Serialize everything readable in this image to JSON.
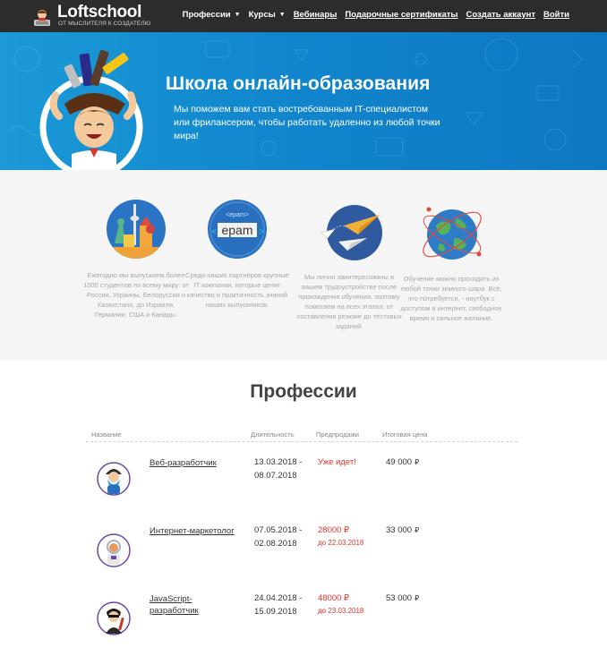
{
  "nav": {
    "logo_name": "Loftschool",
    "logo_tagline": "ОТ МЫСЛИТЕЛЯ К СОЗДАТЕЛЮ",
    "links": [
      {
        "label": "Профессии",
        "has_caret": true
      },
      {
        "label": "Курсы",
        "has_caret": true
      },
      {
        "label": "Вебинары"
      },
      {
        "label": "Подарочные сертификаты"
      },
      {
        "label": "Создать аккаунт"
      },
      {
        "label": "Войти"
      }
    ]
  },
  "hero": {
    "title": "Школа онлайн-образования",
    "subtitle": "Мы поможем вам стать востребованным IT-специалистом или фрилансером, чтобы работать удаленно из любой точки мира!"
  },
  "features": [
    {
      "icon": "world-landmarks-icon",
      "text": "Ежегодно мы выпускаем более 1000 студентов по всему миру: от России, Украины, Белоруссии и Казахстана, до Израиля, Германии, США и Канады."
    },
    {
      "icon": "epam-logo-icon",
      "logo_small": "<epam>",
      "logo_big": "epam",
      "text": "Среди наших партнёров крупные IT компании, которые ценят качество и практичность знаний наших выпускников."
    },
    {
      "icon": "paper-planes-icon",
      "text": "Мы лично заинтересованы в вашем трудоустройстве после прохождения обучения, поэтому помогаем на всех этапах: от составления резюме до тестовых заданий."
    },
    {
      "icon": "globe-orbit-icon",
      "text": "Обучение можно проходить из любой точки земного шара. Всё, что потребуется, - ноутбук с доступом в интернет, свободное время и сильное желание."
    }
  ],
  "professions": {
    "title": "Профессии",
    "columns": [
      "Название",
      "Длительность",
      "Предпродажи",
      "Итоговая цена"
    ],
    "rows": [
      {
        "name": "Веб-разработчик",
        "start": "13.03.2018 -",
        "end": "08.07.2018",
        "presale": "Уже идет!",
        "presale_until": "",
        "price": "49 000",
        "currency": "₽",
        "avatar": "web-developer-avatar-icon"
      },
      {
        "name": "Интернет-маркетолог",
        "start": "07.05.2018 -",
        "end": "02.08.2018",
        "presale": "28000 ₽",
        "presale_until": "до 22.03.2018",
        "price": "33 000",
        "currency": "₽",
        "avatar": "marketer-avatar-icon"
      },
      {
        "name": "JavaScript-разработчик",
        "start": "24.04.2018 -",
        "end": "15.09.2018",
        "presale": "48000 ₽",
        "presale_until": "до 23.03.2018",
        "price": "53 000",
        "currency": "₽",
        "avatar": "js-developer-avatar-icon"
      }
    ]
  },
  "colors": {
    "nav_bg": "#2c2c2c",
    "hero_blue": "#1186cd",
    "presale_red": "#e2342b",
    "features_bg": "#f5f5f5"
  }
}
